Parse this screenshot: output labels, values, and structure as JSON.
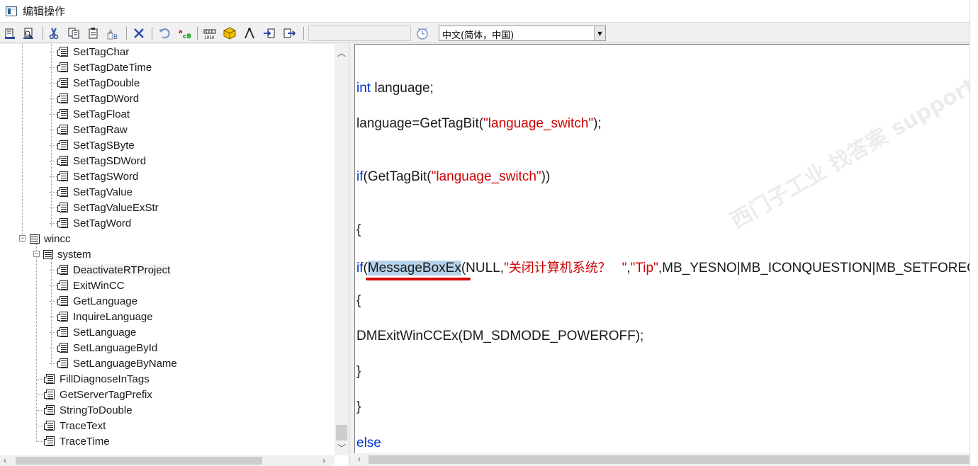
{
  "window": {
    "title": "编辑操作"
  },
  "toolbar": {
    "icons": [
      "compile-icon",
      "compile-all-icon",
      "cut-icon",
      "copy-icon",
      "paste-icon",
      "replace-icon",
      "delete-icon",
      "undo-icon",
      "spellcheck-icon",
      "binary-icon",
      "cube-icon",
      "compass-icon",
      "import-icon",
      "export-icon"
    ],
    "input_value": "",
    "language": "中文(简体，中国)"
  },
  "tree": {
    "functions_top": [
      "SetTagChar",
      "SetTagDateTime",
      "SetTagDouble",
      "SetTagDWord",
      "SetTagFloat",
      "SetTagRaw",
      "SetTagSByte",
      "SetTagSDWord",
      "SetTagSWord",
      "SetTagValue",
      "SetTagValueExStr",
      "SetTagWord"
    ],
    "wincc": {
      "label": "wincc",
      "system": {
        "label": "system",
        "functions": [
          "DeactivateRTProject",
          "ExitWinCC",
          "GetLanguage",
          "InquireLanguage",
          "SetLanguage",
          "SetLanguageById",
          "SetLanguageByName"
        ]
      },
      "functions": [
        "FillDiagnoseInTags",
        "GetServerTagPrefix",
        "StringToDouble",
        "TraceText",
        "TraceTime"
      ]
    }
  },
  "code": {
    "l1_kw": "int",
    "l1_rest": " language;",
    "l2_a": "language=GetTagBit(",
    "l2_str": "\"language_switch\"",
    "l2_b": ");",
    "l3_kw": "if",
    "l3_a": "(GetTagBit(",
    "l3_str": "\"language_switch\"",
    "l3_b": "))",
    "l4": "{",
    "l5_kw": "if",
    "l5_paren": "(",
    "l5_fn": "MessageBoxEx",
    "l5_a": "(NULL,",
    "l5_q1": "\"",
    "l5_cn": "关闭计算机系统？",
    "l5_q2": "   \"",
    "l5_comma": ",",
    "l5_tip": "\"Tip\"",
    "l5_rest": ",MB_YESNO|MB_ICONQUESTION|MB_SETFOREGROUND|MB_TOPMOST",
    "l6": "{",
    "l7": "DMExitWinCCEx(DM_SDMODE_POWEROFF);",
    "l8": "}",
    "l9": "}",
    "l10_kw": "else"
  },
  "watermark": "西门子工业  找答案  support.industry.siemens.com/cs"
}
